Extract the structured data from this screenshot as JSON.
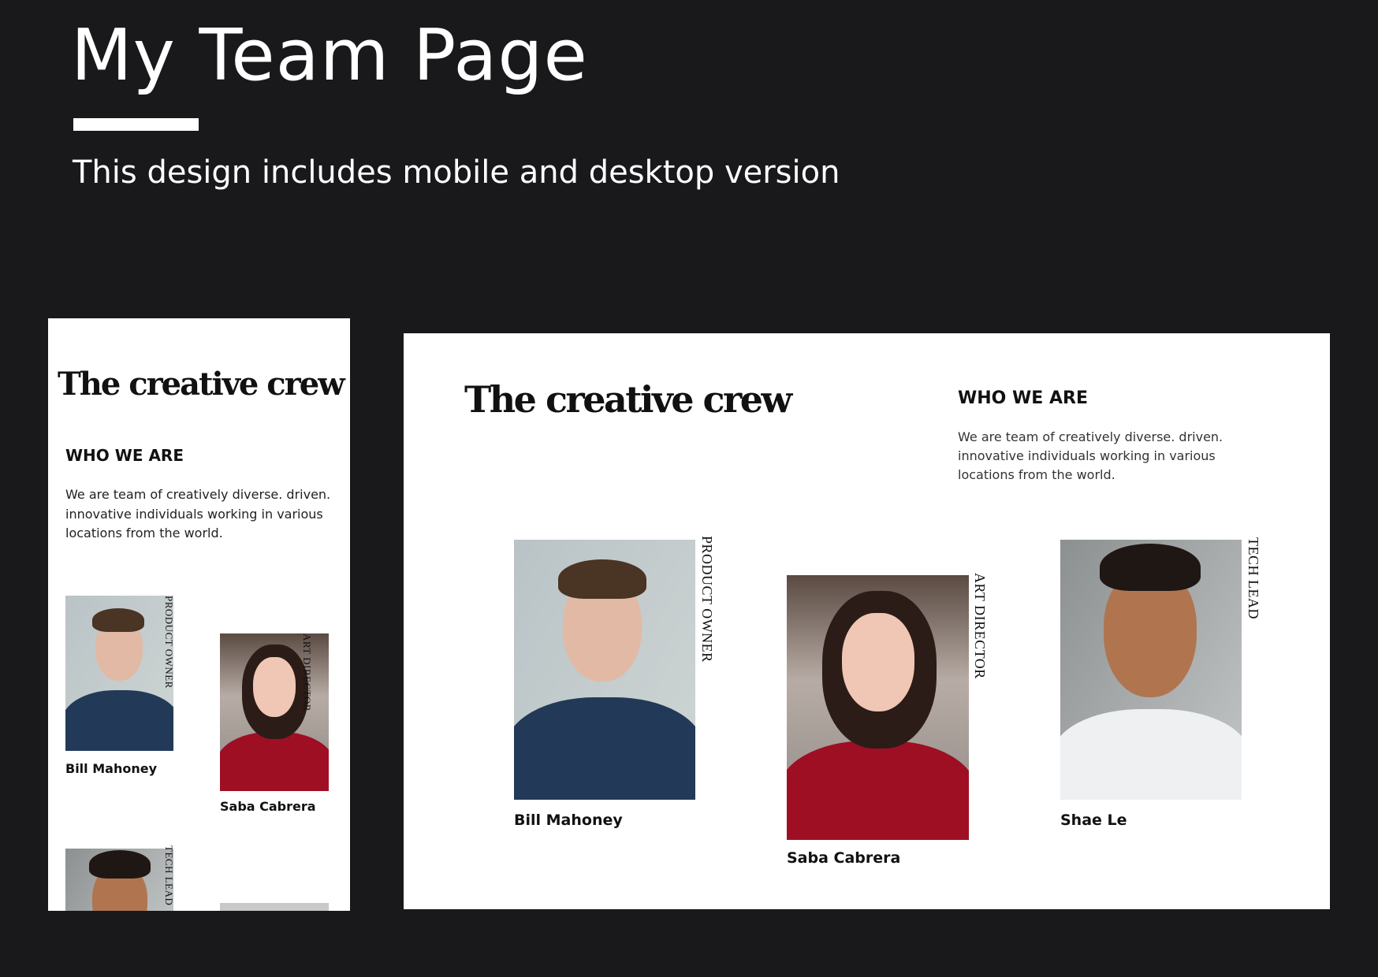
{
  "page": {
    "title": "My Team Page",
    "subtitle": "This design includes mobile and desktop version"
  },
  "mobile": {
    "heading": "The creative crew",
    "section_title": "WHO WE ARE",
    "description_lines": [
      "We are team of creatively diverse. driven.",
      "innovative individuals working in various",
      "locations from the world."
    ],
    "members": [
      {
        "name": "Bill Mahoney",
        "role": "PRODUCT OWNER"
      },
      {
        "name": "Saba Cabrera",
        "role": "ART DIRECTOR"
      },
      {
        "role": "TECH LEAD"
      }
    ]
  },
  "desktop": {
    "heading": "The creative crew",
    "section_title": "WHO WE ARE",
    "description_lines": [
      "We are team of creatively diverse. driven.",
      "innovative individuals working in various",
      "locations from the world."
    ],
    "members": [
      {
        "name": "Bill Mahoney",
        "role": "PRODUCT OWNER"
      },
      {
        "name": "Saba Cabrera",
        "role": "ART DIRECTOR"
      },
      {
        "name": "Shae Le",
        "role": "TECH LEAD"
      }
    ]
  },
  "colors": {
    "background": "#19191b",
    "card": "#ffffff",
    "text": "#111111"
  }
}
